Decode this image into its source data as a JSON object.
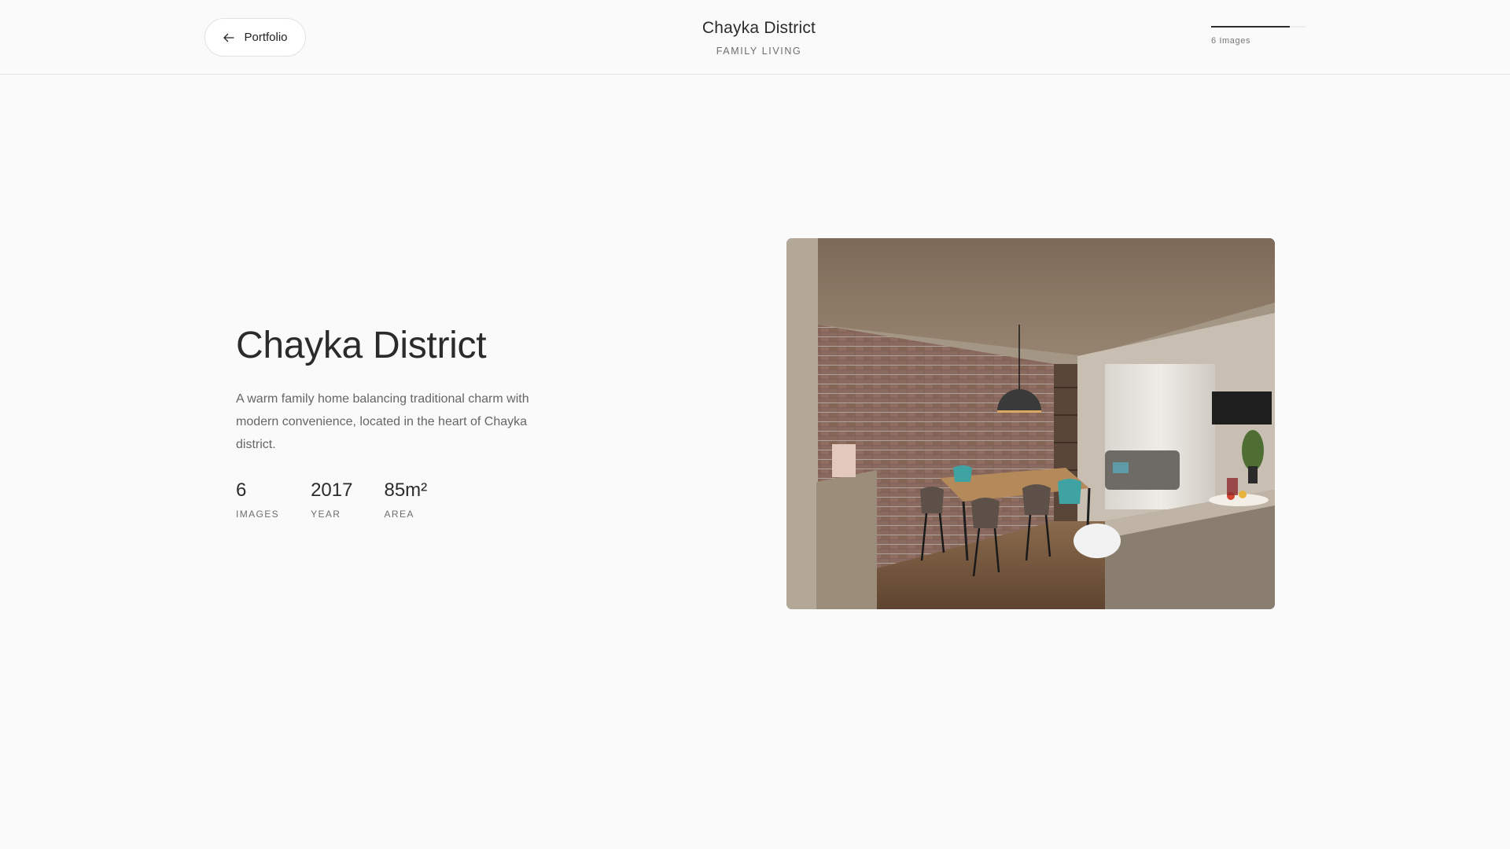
{
  "header": {
    "back_label": "Portfolio",
    "title": "Chayka District",
    "subtitle": "FAMILY LIVING",
    "progress_label": "6 Images",
    "progress_fraction": 0.83
  },
  "project": {
    "title": "Chayka District",
    "description": "A warm family home balancing traditional charm with modern convenience, located in the heart of Chayka district.",
    "stats": [
      {
        "value": "6",
        "label": "IMAGES"
      },
      {
        "value": "2017",
        "label": "YEAR"
      },
      {
        "value": "85m²",
        "label": "AREA"
      }
    ]
  },
  "image": {
    "icon": "interior-render-image"
  }
}
